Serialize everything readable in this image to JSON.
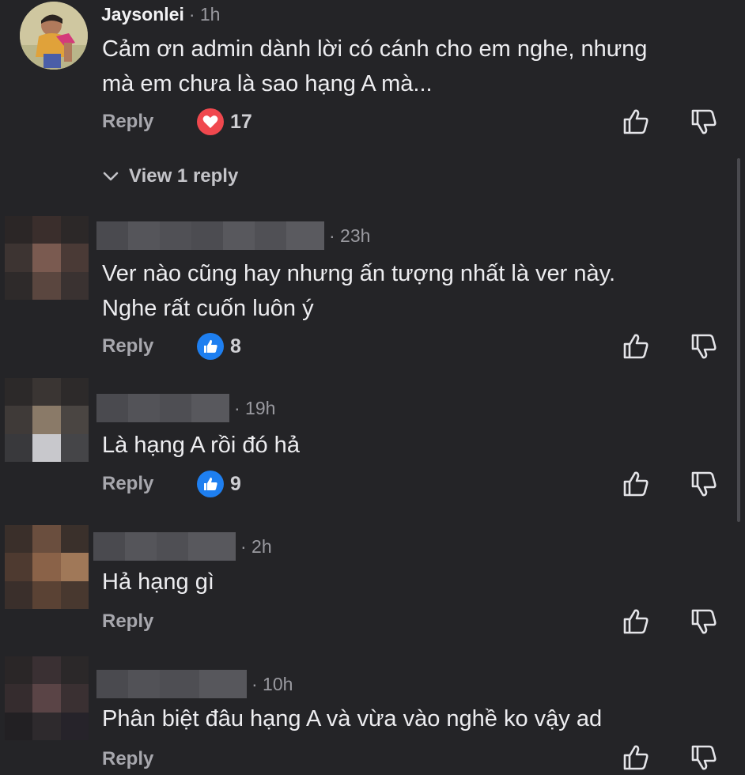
{
  "comments": [
    {
      "author": "Jaysonlei",
      "time": "· 1h",
      "text_lines": [
        "Cảm ơn admin dành lời có cánh cho em nghe, nhưng",
        "mà em chưa là sao hạng A mà..."
      ],
      "reply_label": "Reply",
      "reaction_icon": "heart-icon",
      "reaction_color": "#f0484e",
      "reaction_count": "17",
      "view_replies": "View 1 reply"
    },
    {
      "author": "",
      "time": "· 23h",
      "text_lines": [
        "Ver nào cũng hay nhưng ấn tượng nhất là ver này.",
        "Nghe rất cuốn luôn ý"
      ],
      "reply_label": "Reply",
      "reaction_icon": "like-icon",
      "reaction_color": "#1e7ff0",
      "reaction_count": "8"
    },
    {
      "author": "",
      "time": "· 19h",
      "text_lines": [
        "Là hạng A rồi đó hả"
      ],
      "reply_label": "Reply",
      "reaction_icon": "like-icon",
      "reaction_color": "#1e7ff0",
      "reaction_count": "9"
    },
    {
      "author": "",
      "time": "· 2h",
      "text_lines": [
        "Hả hạng gì"
      ],
      "reply_label": "Reply"
    },
    {
      "author": "",
      "time": "· 10h",
      "text_lines": [
        "Phân biệt đâu hạng A và vừa vào nghề ko vậy ad"
      ],
      "reply_label": "Reply"
    }
  ],
  "icons": {
    "upvote": "thumbs-up-outline-icon",
    "downvote": "thumbs-down-outline-icon",
    "expand": "chevron-down-icon"
  }
}
